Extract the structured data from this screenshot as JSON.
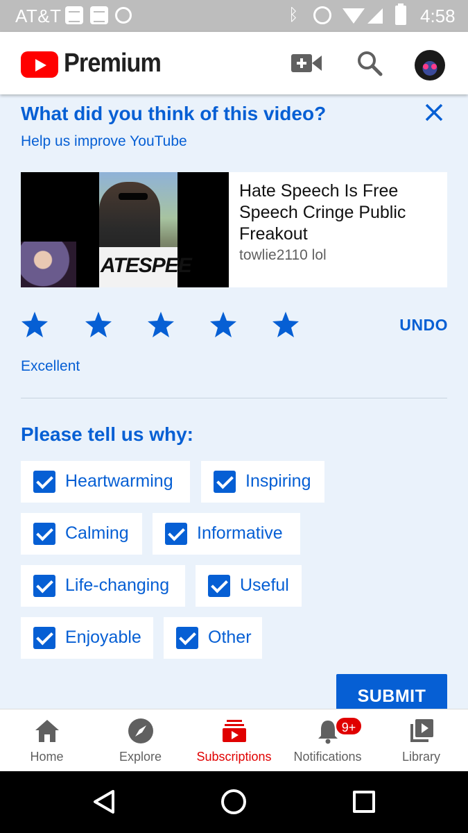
{
  "status_bar": {
    "carrier": "AT&T",
    "time": "4:58",
    "bluetooth": "ᛒ"
  },
  "app_bar": {
    "brand": "Premium",
    "icons": [
      "youtube-logo-icon",
      "add-video-icon",
      "search-icon",
      "avatar"
    ]
  },
  "survey": {
    "title": "What did you think of this video?",
    "subtitle": "Help us improve YouTube",
    "video": {
      "title": "Hate Speech Is Free Speech Cringe Public Freakout",
      "channel": "towlie2110 lol",
      "thumbnail_sign_text": "ATESPEE"
    },
    "rating": {
      "stars_filled": 5,
      "stars_total": 5,
      "label": "Excellent",
      "undo_label": "UNDO"
    },
    "why_title": "Please tell us why:",
    "reasons": [
      {
        "label": "Heartwarming",
        "checked": true
      },
      {
        "label": "Inspiring",
        "checked": true
      },
      {
        "label": "Calming",
        "checked": true
      },
      {
        "label": "Informative",
        "checked": true
      },
      {
        "label": "Life-changing",
        "checked": true
      },
      {
        "label": "Useful",
        "checked": true
      },
      {
        "label": "Enjoyable",
        "checked": true
      },
      {
        "label": "Other",
        "checked": true
      }
    ],
    "submit_label": "SUBMIT"
  },
  "bottom_nav": {
    "items": [
      {
        "label": "Home",
        "icon": "home-icon",
        "active": false
      },
      {
        "label": "Explore",
        "icon": "compass-icon",
        "active": false
      },
      {
        "label": "Subscriptions",
        "icon": "subscriptions-icon",
        "active": true
      },
      {
        "label": "Notifications",
        "icon": "bell-icon",
        "active": false,
        "badge": "9+"
      },
      {
        "label": "Library",
        "icon": "library-icon",
        "active": false
      }
    ]
  },
  "colors": {
    "accent": "#065fd4",
    "brand_red": "#ff0000",
    "active_nav": "#e00000",
    "background": "#eaf2fb"
  }
}
